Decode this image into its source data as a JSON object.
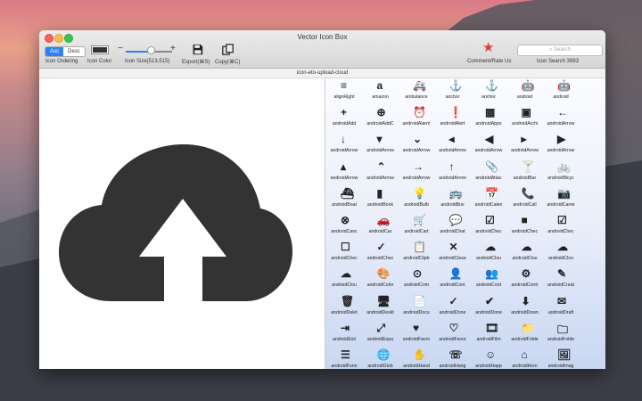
{
  "window": {
    "title": "Vector Icon Box"
  },
  "toolbar": {
    "ordering": {
      "asc": "Asc",
      "desc": "Desc",
      "label": "Icon Ordering"
    },
    "color": {
      "label": "Icon Color",
      "value": "#333333"
    },
    "size": {
      "label": "Icon Size(513,515)",
      "minus": "−",
      "plus": "+",
      "level": 0.55
    },
    "export": {
      "label": "Export(⌘S)"
    },
    "copy": {
      "label": "Copy(⌘C)"
    },
    "rate": {
      "label": "Comment/Rate Us"
    },
    "search": {
      "placeholder": "Search",
      "label": "Icon Search 3993"
    }
  },
  "selected_icon": {
    "name": "icon-eto-upload-cloud"
  },
  "colors": {
    "accent": "#2f82f5",
    "icon": "#333333",
    "star": "#d9413b"
  },
  "icon_grid": {
    "rows": [
      [
        "alignRight",
        "amazon",
        "ambulance",
        "anchor",
        "anchor",
        "android",
        "android"
      ],
      [
        "androidAdd",
        "androidAddC",
        "androidAlarm",
        "androidAlert",
        "androidApps",
        "androidArchi",
        "androidArrow"
      ],
      [
        "androidArrow",
        "androidArrow",
        "androidArrow",
        "androidArrow",
        "androidArrow",
        "androidArrow",
        "androidArrow"
      ],
      [
        "androidArrow",
        "androidArrow",
        "androidArrow",
        "androidArrow",
        "androidAttac",
        "androidBar",
        "androidBicyc"
      ],
      [
        "androidBoat",
        "androidBook",
        "androidBulb",
        "androidBus",
        "androidCalen",
        "androidCall",
        "androidCame"
      ],
      [
        "androidCanc",
        "androidCar",
        "androidCart",
        "androidChat",
        "androidChec",
        "androidChec",
        "androidChec"
      ],
      [
        "androidChec",
        "androidChec",
        "androidClipb",
        "androidClose",
        "androidClou",
        "androidClou",
        "androidClou"
      ],
      [
        "androidClou",
        "androidColor",
        "androidCom",
        "androidCont",
        "androidCont",
        "androidContr",
        "androidCreat"
      ],
      [
        "androidDelet",
        "androidDeskt",
        "androidDocu",
        "androidDone",
        "androidDone",
        "androidDown",
        "androidDraft"
      ],
      [
        "androidExit",
        "androidExpa",
        "androidFavor",
        "androidFavor",
        "androidFilm",
        "androidFolde",
        "androidFolde"
      ],
      [
        "androidFunn",
        "androidGlob",
        "androidHand",
        "androidHang",
        "androidHapp",
        "androidHom",
        "androidImag"
      ]
    ],
    "glyphs": [
      [
        "≡",
        "a",
        "🚑",
        "⚓",
        "⚓",
        "🤖",
        "🤖"
      ],
      [
        "+",
        "⊕",
        "⏰",
        "❗",
        "▦",
        "▣",
        "←"
      ],
      [
        "↓",
        "▾",
        "⌄",
        "◂",
        "◀",
        "▸",
        "▶"
      ],
      [
        "▴",
        "⌃",
        "→",
        "↑",
        "📎",
        "🍸",
        "🚲"
      ],
      [
        "⛴",
        "▮",
        "💡",
        "🚌",
        "📅",
        "📞",
        "📷"
      ],
      [
        "⊗",
        "🚗",
        "🛒",
        "💬",
        "☑",
        "■",
        "☑"
      ],
      [
        "☐",
        "✓",
        "📋",
        "✕",
        "☁",
        "☁",
        "☁"
      ],
      [
        "☁",
        "🎨",
        "⊙",
        "👤",
        "👥",
        "⚙",
        "✎"
      ],
      [
        "🗑",
        "🖥",
        "📄",
        "✓",
        "✔",
        "⬇",
        "✉"
      ],
      [
        "⇥",
        "⤢",
        "♥",
        "♡",
        "🎞",
        "📁",
        "🗀"
      ],
      [
        "☰",
        "🌐",
        "✋",
        "☏",
        "☺",
        "⌂",
        "🖼"
      ]
    ]
  }
}
